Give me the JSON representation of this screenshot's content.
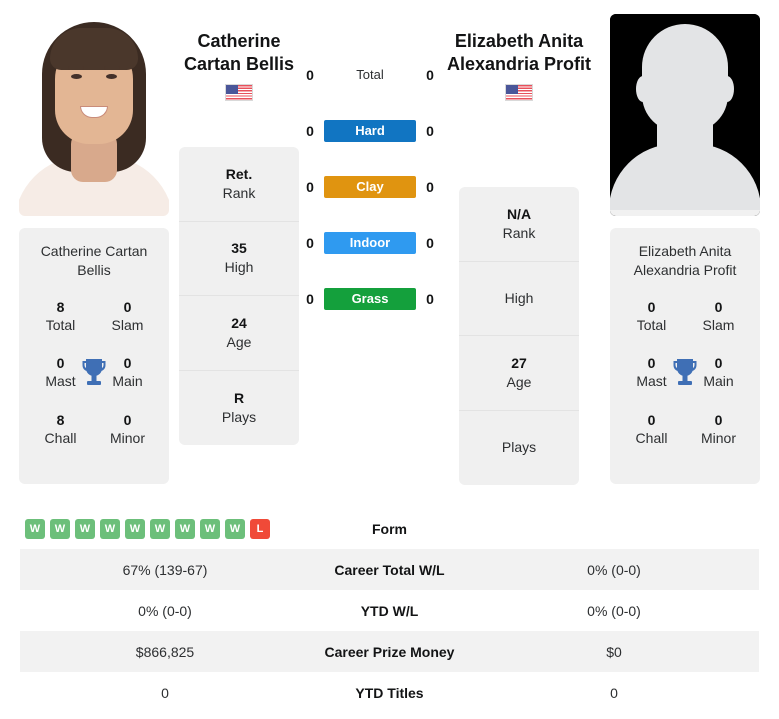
{
  "players": {
    "left": {
      "name_line1": "Catherine",
      "name_line2": "Cartan Bellis",
      "card_name": "Catherine Cartan Bellis",
      "flag": "us-flag-icon",
      "photo": "player-photo",
      "ranks": [
        {
          "value": "Ret.",
          "label": "Rank"
        },
        {
          "value": "35",
          "label": "High"
        },
        {
          "value": "24",
          "label": "Age"
        },
        {
          "value": "R",
          "label": "Plays"
        }
      ],
      "titles": [
        {
          "value": "8",
          "label": "Total"
        },
        {
          "value": "0",
          "label": "Slam"
        },
        {
          "value": "0",
          "label": "Mast"
        },
        {
          "value": "0",
          "label": "Main"
        },
        {
          "value": "8",
          "label": "Chall"
        },
        {
          "value": "0",
          "label": "Minor"
        }
      ],
      "surface_counts": [
        "0",
        "0",
        "0",
        "0",
        "0"
      ]
    },
    "right": {
      "name_line1": "Elizabeth Anita",
      "name_line2": "Alexandria Profit",
      "card_name": "Elizabeth Anita Alexandria Profit",
      "flag": "us-flag-icon",
      "photo": "player-photo-placeholder",
      "ranks": [
        {
          "value": "N/A",
          "label": "Rank"
        },
        {
          "value": "",
          "label": "High"
        },
        {
          "value": "27",
          "label": "Age"
        },
        {
          "value": "",
          "label": "Plays"
        }
      ],
      "titles": [
        {
          "value": "0",
          "label": "Total"
        },
        {
          "value": "0",
          "label": "Slam"
        },
        {
          "value": "0",
          "label": "Mast"
        },
        {
          "value": "0",
          "label": "Main"
        },
        {
          "value": "0",
          "label": "Chall"
        },
        {
          "value": "0",
          "label": "Minor"
        }
      ],
      "surface_counts": [
        "0",
        "0",
        "0",
        "0",
        "0"
      ]
    }
  },
  "surfaces": [
    {
      "label": "Total",
      "color": "transparent",
      "left": "0",
      "right": "0"
    },
    {
      "label": "Hard",
      "color": "#1175c2",
      "left": "0",
      "right": "0"
    },
    {
      "label": "Clay",
      "color": "#e09410",
      "left": "0",
      "right": "0"
    },
    {
      "label": "Indoor",
      "color": "#2f9af0",
      "left": "0",
      "right": "0"
    },
    {
      "label": "Grass",
      "color": "#14a03c",
      "left": "0",
      "right": "0"
    }
  ],
  "form": {
    "label": "Form",
    "left_results": [
      {
        "result": "W"
      },
      {
        "result": "W"
      },
      {
        "result": "W"
      },
      {
        "result": "W"
      },
      {
        "result": "W"
      },
      {
        "result": "W"
      },
      {
        "result": "W"
      },
      {
        "result": "W"
      },
      {
        "result": "W"
      },
      {
        "result": "L"
      }
    ],
    "right_results": [],
    "win_color": "#6cbf7a",
    "loss_color": "#f04a38"
  },
  "stats_rows": [
    {
      "label": "Career Total W/L",
      "left": "67% (139-67)",
      "right": "0% (0-0)"
    },
    {
      "label": "YTD W/L",
      "left": "0% (0-0)",
      "right": "0% (0-0)"
    },
    {
      "label": "Career Prize Money",
      "left": "$866,825",
      "right": "$0"
    },
    {
      "label": "YTD Titles",
      "left": "0",
      "right": "0"
    }
  ],
  "colors": {
    "panel_bg": "#f0f0f0",
    "row_alt_bg": "#f2f2f2",
    "trophy": "#3f6fb5"
  }
}
